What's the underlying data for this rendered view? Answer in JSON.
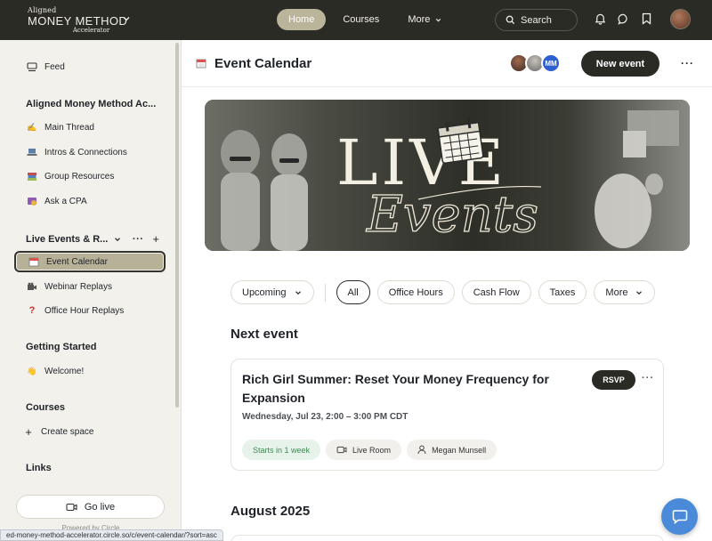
{
  "brand": {
    "line1": "Aligned",
    "line2": "MONEY METHOD",
    "line3": "Accelerator"
  },
  "nav": {
    "home": "Home",
    "courses": "Courses",
    "more": "More"
  },
  "search": {
    "label": "Search"
  },
  "sidebar": {
    "feed": "Feed",
    "group1_title": "Aligned Money Method Ac...",
    "group1_items": [
      "Main Thread",
      "Intros & Connections",
      "Group Resources",
      "Ask a CPA"
    ],
    "group2_title": "Live Events & R...",
    "group2_items": [
      "Event Calendar",
      "Webinar Replays",
      "Office Hour Replays"
    ],
    "group3_title": "Getting Started",
    "group3_items": [
      "Welcome!"
    ],
    "courses_title": "Courses",
    "create_space": "Create space",
    "links_title": "Links",
    "go_live": "Go live",
    "powered_by": "Powered by Circle"
  },
  "url_status": "ed-money-method-accelerator.circle.so/c/event-calendar/?sort=asc",
  "header": {
    "title": "Event Calendar",
    "avatars": [
      "",
      "",
      "MM"
    ],
    "new_event": "New event"
  },
  "banner": {
    "word1": "LIVE",
    "word2": "Events"
  },
  "filters": {
    "dropdown": "Upcoming",
    "tags": [
      "All",
      "Office Hours",
      "Cash Flow",
      "Taxes"
    ],
    "more": "More",
    "selected": "All"
  },
  "next_event_heading": "Next event",
  "event": {
    "title": "Rich Girl Summer: Reset Your Money Frequency for Expansion",
    "date": "Wednesday, Jul 23, 2:00 – 3:00 PM CDT",
    "rsvp": "RSVP",
    "starts": "Starts in 1 week",
    "location": "Live Room",
    "host": "Megan Munsell"
  },
  "month_heading": "August 2025",
  "colors": {
    "topbar": "#2a2b24",
    "accent_pill": "#b9b49a",
    "sidebar_bg": "#f3f1ec",
    "chat_fab": "#4b8ad9"
  }
}
